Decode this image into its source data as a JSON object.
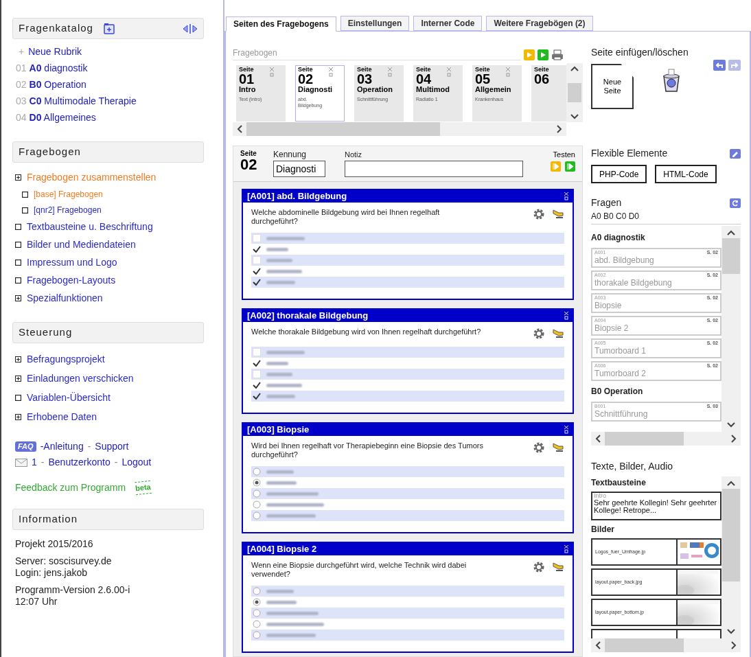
{
  "sidebar": {
    "catalog": {
      "title": "Fragenkatalog",
      "new_item": "Neue Rubrik",
      "new_prefix": "+",
      "items": [
        {
          "num": "01",
          "code": "A0",
          "name": "diagnostik"
        },
        {
          "num": "02",
          "code": "B0",
          "name": "Operation"
        },
        {
          "num": "03",
          "code": "C0",
          "name": "Multimodale Therapie"
        },
        {
          "num": "04",
          "code": "D0",
          "name": "Allgemeines"
        }
      ]
    },
    "questionnaire": {
      "title": "Fragebogen",
      "items": [
        {
          "label": "Fragebogen zusammenstellen",
          "kind": "group",
          "selected": true,
          "children": [
            {
              "label": "[base] Fragebogen",
              "kind": "page",
              "selected": true
            },
            {
              "label": "[qnr2] Fragebogen",
              "kind": "page",
              "selected": false
            }
          ]
        },
        {
          "label": "Textbausteine u. Beschriftung",
          "kind": "page",
          "selected": false
        },
        {
          "label": "Bilder und Mediendateien",
          "kind": "page",
          "selected": false
        },
        {
          "label": "Impressum und Logo",
          "kind": "page",
          "selected": false
        },
        {
          "label": "Fragebogen-Layouts",
          "kind": "page",
          "selected": false
        },
        {
          "label": "Spezialfunktionen",
          "kind": "group",
          "selected": false
        }
      ]
    },
    "control": {
      "title": "Steuerung",
      "items": [
        {
          "label": "Befragungsprojekt",
          "kind": "group"
        },
        {
          "label": "Einladungen verschicken",
          "kind": "group"
        },
        {
          "label": "Variablen-Übersicht",
          "kind": "page"
        },
        {
          "label": "Erhobene Daten",
          "kind": "group"
        }
      ]
    },
    "links": {
      "faq_badge": "FAQ",
      "help": [
        "-Anleitung",
        "Support"
      ],
      "sep": "-",
      "mail_count": "1",
      "account": [
        "Benutzerkonto",
        "Logout"
      ],
      "feedback": "Feedback zum Programm",
      "beta_badge": "beta"
    },
    "information": {
      "title": "Information",
      "lines": [
        "Projekt 2015/2016",
        "Server: soscisurvey.de\nLogin: jens.jakob",
        "Programm-Version 2.6.00-i\n12:07 Uhr"
      ]
    }
  },
  "tabs": [
    {
      "label": "Seiten des Fragebogens",
      "selected": true
    },
    {
      "label": "Einstellungen",
      "selected": false
    },
    {
      "label": "Interner Code",
      "selected": false
    },
    {
      "label": "Weitere Fragebögen (2)",
      "selected": false
    }
  ],
  "pages": {
    "label": "Fragebogen",
    "items": [
      {
        "seite": "Seite",
        "num": "01",
        "title": "Intro",
        "desc": "Text (Intro)",
        "selected": false
      },
      {
        "seite": "Seite",
        "num": "02",
        "title": "Diagnosti",
        "desc": "abd. Bildgebung",
        "selected": true
      },
      {
        "seite": "Seite",
        "num": "03",
        "title": "Operation",
        "desc": "Schnittführung",
        "selected": false
      },
      {
        "seite": "Seite",
        "num": "04",
        "title": "Multimod",
        "desc": "Radiatio 1",
        "selected": false
      },
      {
        "seite": "Seite",
        "num": "05",
        "title": "Allgemein",
        "desc": "Krankenhaus",
        "selected": false
      },
      {
        "seite": "Seite",
        "num": "06",
        "selected": false
      }
    ]
  },
  "page_header": {
    "seite": "Seite",
    "num": "02",
    "id_label": "Kennung",
    "id_value": "Diagnosti",
    "note_label": "Notiz",
    "test_label": "Testen"
  },
  "questions": [
    {
      "title": "[A001] abd. Bildgebung",
      "text": "Welche abdominelle Bildgebung wird bei Ihnen regelhaft durchgeführt?",
      "kind": "checkbox",
      "options": [
        {
          "checked": false
        },
        {
          "checked": true
        },
        {
          "checked": false
        },
        {
          "checked": true
        },
        {
          "checked": true
        }
      ]
    },
    {
      "title": "[A002] thorakale Bildgebung",
      "text": "Welche thorakale Bildgebung wird von Ihnen regelhaft durchgeführt?",
      "kind": "checkbox",
      "options": [
        {
          "checked": false
        },
        {
          "checked": true
        },
        {
          "checked": false
        },
        {
          "checked": true
        },
        {
          "checked": true
        }
      ]
    },
    {
      "title": "[A003] Biopsie",
      "text": "Wird bei Ihnen regelhaft vor Therapiebeginn eine Biopsie des Tumors durchgeführt?",
      "kind": "radio",
      "options": [
        {
          "selected": false
        },
        {
          "selected": true
        },
        {
          "selected": false
        },
        {
          "selected": false
        },
        {
          "selected": false
        }
      ]
    },
    {
      "title": "[A004] Biopsie 2",
      "text": "Wenn eine Biopsie durchgeführt wird, welche Technik wird dabei verwendet?",
      "kind": "radio",
      "options": [
        {
          "selected": false
        },
        {
          "selected": true
        },
        {
          "selected": false
        },
        {
          "selected": false
        },
        {
          "selected": false
        }
      ]
    }
  ],
  "right": {
    "insert": {
      "title": "Seite einfügen/löschen",
      "new_page": "Neue\nSeite"
    },
    "flexible": {
      "title": "Flexible Elemente",
      "buttons": [
        "PHP-Code",
        "HTML-Code"
      ]
    },
    "questions": {
      "title": "Fragen",
      "filter": "A0 B0 C0 D0",
      "groups": [
        {
          "name": "A0 diagnostik",
          "items": [
            {
              "id": "A001",
              "name": "abd. Bildgebung",
              "page": "S. 02"
            },
            {
              "id": "A002",
              "name": "thorakale Bildgebung",
              "page": "S. 02"
            },
            {
              "id": "A003",
              "name": "Biopsie",
              "page": "S. 02"
            },
            {
              "id": "A004",
              "name": "Biopsie 2",
              "page": "S. 02"
            },
            {
              "id": "A005",
              "name": "Tumorboard 1",
              "page": "S. 02"
            },
            {
              "id": "A006",
              "name": "Tumorboard 2",
              "page": "S. 02"
            }
          ]
        },
        {
          "name": "B0 Operation",
          "items": [
            {
              "id": "B001",
              "name": "Schnittführung",
              "page": "S. 03"
            }
          ]
        }
      ]
    },
    "media": {
      "title": "Texte, Bilder, Audio",
      "texts_label": "Textbausteine",
      "texts": [
        {
          "id": "Intro",
          "text": "Sehr geehrte Kollegin! Sehr geehrter Kollege! Retrope..."
        }
      ],
      "images_label": "Bilder",
      "images": [
        {
          "name": "Logos_fuer_Umfrage.jp"
        },
        {
          "name": "layout.paper_back.jpg"
        },
        {
          "name": "layout.paper_bottom.jp"
        }
      ]
    }
  }
}
